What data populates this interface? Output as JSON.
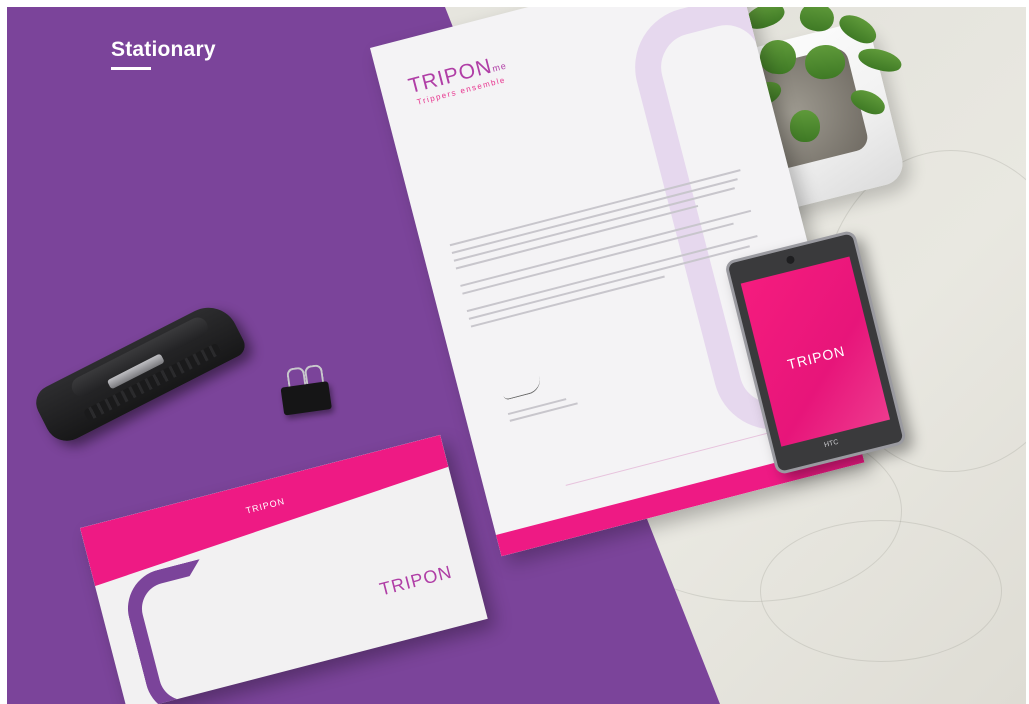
{
  "page": {
    "heading": "Stationary"
  },
  "brand": {
    "logo_text": "TRIPON",
    "logo_suffix": "me",
    "tagline": "Trippers ensemble"
  },
  "phone": {
    "brand": "HTC"
  },
  "colors": {
    "purple_background": "#7b449a",
    "magenta_accent": "#ee1a84",
    "marble_surface": "#e6e5df",
    "logo_purple": "#b03ea6"
  },
  "icons": {
    "plant": "succulent-plant",
    "stapler": "stapler",
    "clip": "binder-clip"
  }
}
